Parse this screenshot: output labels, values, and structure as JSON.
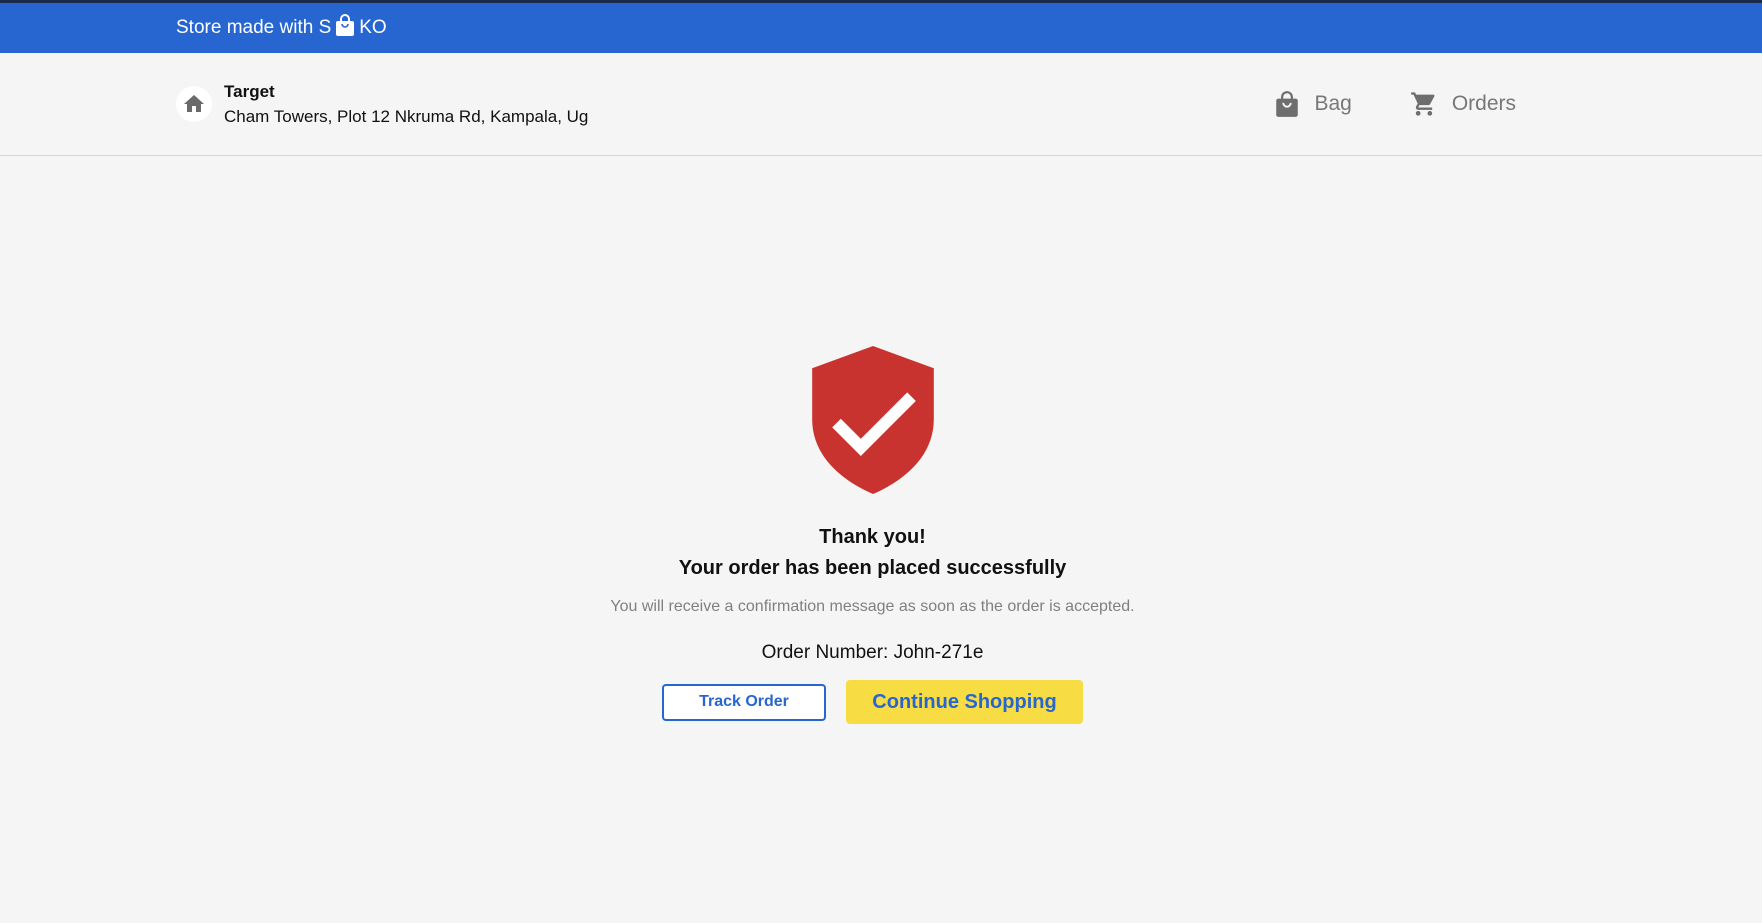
{
  "banner": {
    "text_before_logo": "Store made with S",
    "logo_icon": "shopping-bag-icon",
    "text_after_logo": "KO",
    "background": "#2766d0"
  },
  "store": {
    "icon": "home-icon",
    "name": "Target",
    "address": "Cham Towers, Plot 12 Nkruma Rd, Kampala, Ug"
  },
  "nav": {
    "bag": {
      "label": "Bag",
      "icon": "bag-icon"
    },
    "orders": {
      "label": "Orders",
      "icon": "cart-icon"
    }
  },
  "confirmation": {
    "icon": "shield-check-icon",
    "icon_color": "#c9332f",
    "thanks": "Thank you!",
    "placed": "Your order has been placed successfully",
    "note": "You will receive a confirmation message as soon as the order is accepted.",
    "order_number_label": "Order Number:",
    "order_number": "John-271e"
  },
  "buttons": {
    "track_order": "Track Order",
    "continue_shopping": "Continue Shopping",
    "primary_color": "#2766d0",
    "accent_color": "#f7dc44"
  }
}
